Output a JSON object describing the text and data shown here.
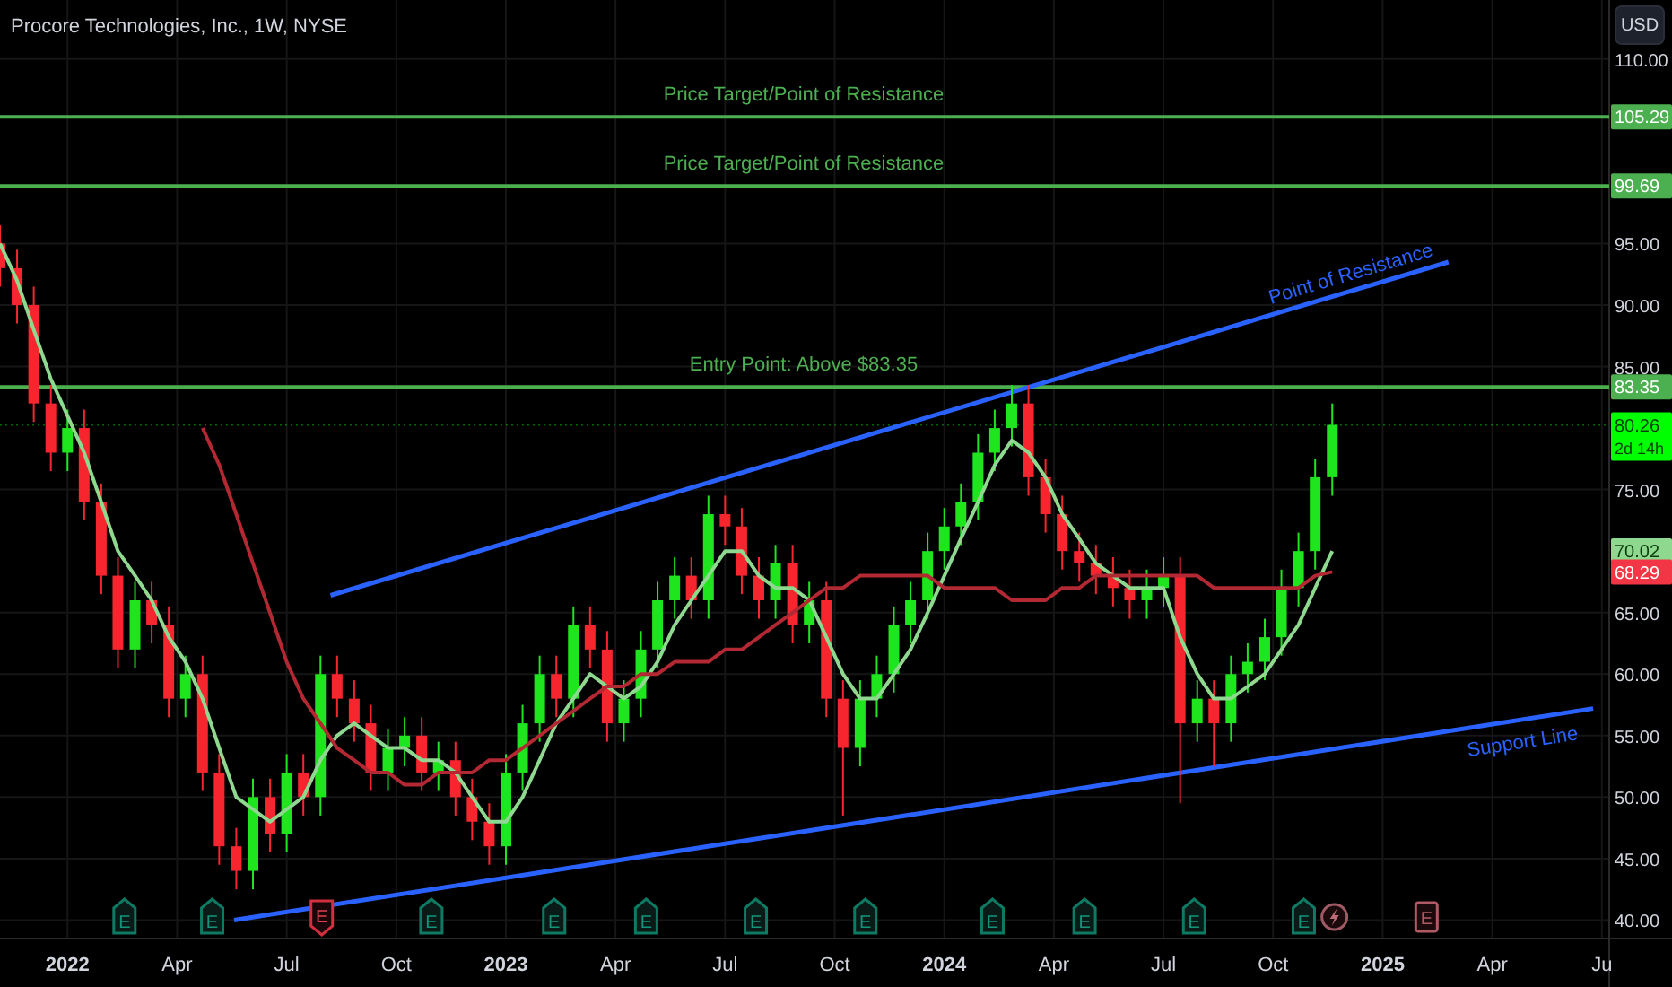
{
  "currency_button": "USD",
  "price_tags": [
    {
      "text": "105.29",
      "color": "#4caf50"
    },
    {
      "text": "99.69",
      "color": "#4caf50"
    },
    {
      "text": "83.35",
      "color": "#4caf50"
    },
    {
      "text": "80.26",
      "subtext": "2d 14h",
      "color": "#00ff00"
    },
    {
      "text": "70.02",
      "color": "#8fd88f"
    },
    {
      "text": "68.29",
      "color": "#f23645"
    }
  ],
  "trend_lines": [
    {
      "label": "Point of Resistance"
    },
    {
      "label": "Support Line"
    }
  ],
  "events": [
    {
      "kind": "earnings",
      "label": "E"
    },
    {
      "kind": "earnings",
      "label": "E"
    },
    {
      "kind": "earnings_miss",
      "label": "E"
    },
    {
      "kind": "earnings",
      "label": "E"
    },
    {
      "kind": "earnings",
      "label": "E"
    },
    {
      "kind": "earnings",
      "label": "E"
    },
    {
      "kind": "earnings",
      "label": "E"
    },
    {
      "kind": "earnings",
      "label": "E"
    },
    {
      "kind": "earnings",
      "label": "E"
    },
    {
      "kind": "earnings",
      "label": "E"
    },
    {
      "kind": "earnings",
      "label": "E"
    },
    {
      "kind": "earnings",
      "label": "E"
    },
    {
      "kind": "flash"
    },
    {
      "kind": "upcoming",
      "label": "E"
    }
  ],
  "chart_data": {
    "type": "candlestick",
    "title": "Procore Technologies, Inc., 1W, NYSE",
    "xlim": [
      2021.846,
      2025.66
    ],
    "grid": true,
    "ylim": [
      38.5,
      114.8
    ],
    "x": [
      2021.846,
      2021.885,
      2021.923,
      2021.962,
      2022.0,
      2022.038,
      2022.077,
      2022.115,
      2022.154,
      2022.192,
      2022.231,
      2022.269,
      2022.308,
      2022.346,
      2022.385,
      2022.423,
      2022.462,
      2022.5,
      2022.538,
      2022.577,
      2022.615,
      2022.654,
      2022.692,
      2022.731,
      2022.769,
      2022.808,
      2022.846,
      2022.885,
      2022.923,
      2022.962,
      2023.0,
      2023.038,
      2023.077,
      2023.115,
      2023.154,
      2023.192,
      2023.231,
      2023.269,
      2023.308,
      2023.346,
      2023.385,
      2023.423,
      2023.462,
      2023.5,
      2023.538,
      2023.577,
      2023.615,
      2023.654,
      2023.692,
      2023.731,
      2023.769,
      2023.808,
      2023.846,
      2023.885,
      2023.923,
      2023.962,
      2024.0,
      2024.038,
      2024.077,
      2024.115,
      2024.154,
      2024.192,
      2024.231,
      2024.269,
      2024.308,
      2024.346,
      2024.385,
      2024.423,
      2024.462,
      2024.5,
      2024.538,
      2024.577,
      2024.615,
      2024.654,
      2024.692,
      2024.731,
      2024.769,
      2024.808,
      2024.846,
      2024.885
    ],
    "ohlc": [
      [
        95,
        96.5,
        91.5,
        93
      ],
      [
        93,
        94.5,
        88.5,
        90
      ],
      [
        90,
        91.5,
        80.5,
        82
      ],
      [
        82,
        83.5,
        76.5,
        78
      ],
      [
        78,
        81.5,
        76.5,
        80
      ],
      [
        80,
        81.5,
        72.5,
        74
      ],
      [
        74,
        75.5,
        66.5,
        68
      ],
      [
        68,
        69.5,
        60.5,
        62
      ],
      [
        62,
        67.5,
        60.5,
        66
      ],
      [
        66,
        67.5,
        62.5,
        64
      ],
      [
        64,
        65.5,
        56.5,
        58
      ],
      [
        58,
        61.5,
        56.5,
        60
      ],
      [
        60,
        61.5,
        50.5,
        52
      ],
      [
        52,
        53.5,
        44.5,
        46
      ],
      [
        46,
        47.5,
        42.5,
        44
      ],
      [
        44,
        51.5,
        42.5,
        50
      ],
      [
        50,
        51.5,
        45.5,
        47
      ],
      [
        47,
        53.5,
        45.5,
        52
      ],
      [
        52,
        53.5,
        48.5,
        50
      ],
      [
        50,
        61.5,
        48.5,
        60
      ],
      [
        60,
        61.5,
        56.5,
        58
      ],
      [
        58,
        59.5,
        54.5,
        56
      ],
      [
        56,
        57.5,
        50.5,
        52
      ],
      [
        52,
        55.5,
        50.5,
        54
      ],
      [
        54,
        56.5,
        52.5,
        55
      ],
      [
        55,
        56.5,
        50.5,
        52
      ],
      [
        52,
        54.5,
        50.5,
        53
      ],
      [
        53,
        54.5,
        48.5,
        50
      ],
      [
        50,
        51.5,
        46.5,
        48
      ],
      [
        48,
        49.5,
        44.5,
        46
      ],
      [
        46,
        53.5,
        44.5,
        52
      ],
      [
        52,
        57.5,
        50.5,
        56
      ],
      [
        56,
        61.5,
        54.5,
        60
      ],
      [
        60,
        61.5,
        56.5,
        58
      ],
      [
        58,
        65.5,
        56.5,
        64
      ],
      [
        64,
        65.5,
        60.5,
        62
      ],
      [
        62,
        63.5,
        54.5,
        56
      ],
      [
        56,
        59.5,
        54.5,
        58
      ],
      [
        58,
        63.5,
        56.5,
        62
      ],
      [
        62,
        67.5,
        60.5,
        66
      ],
      [
        66,
        69.5,
        64.5,
        68
      ],
      [
        68,
        69.5,
        64.5,
        66
      ],
      [
        66,
        74.5,
        64.5,
        73
      ],
      [
        73,
        74.5,
        70.5,
        72
      ],
      [
        72,
        73.5,
        66.5,
        68
      ],
      [
        68,
        69.5,
        64.5,
        66
      ],
      [
        66,
        70.5,
        64.5,
        69
      ],
      [
        69,
        70.5,
        62.5,
        64
      ],
      [
        64,
        67.5,
        62.5,
        66
      ],
      [
        66,
        67.5,
        56.5,
        58
      ],
      [
        58,
        59.5,
        48.5,
        54
      ],
      [
        54,
        59.5,
        52.5,
        58
      ],
      [
        58,
        61.5,
        56.5,
        60
      ],
      [
        60,
        65.5,
        58.5,
        64
      ],
      [
        64,
        67.5,
        62.5,
        66
      ],
      [
        66,
        71.5,
        64.5,
        70
      ],
      [
        70,
        73.5,
        68.5,
        72
      ],
      [
        72,
        75.5,
        70.5,
        74
      ],
      [
        74,
        79.5,
        72.5,
        78
      ],
      [
        78,
        81.5,
        76.5,
        80
      ],
      [
        80,
        83.5,
        78.5,
        82
      ],
      [
        82,
        83.5,
        74.5,
        76
      ],
      [
        76,
        77.5,
        71.5,
        73
      ],
      [
        73,
        74.5,
        68.5,
        70
      ],
      [
        70,
        71.5,
        67.5,
        69
      ],
      [
        69,
        70.5,
        66.5,
        68
      ],
      [
        68,
        69.5,
        65.5,
        67
      ],
      [
        67,
        68.5,
        64.5,
        66
      ],
      [
        66,
        68.5,
        64.5,
        67
      ],
      [
        67,
        69.5,
        65.5,
        68
      ],
      [
        68,
        69.5,
        49.5,
        56
      ],
      [
        56,
        59.5,
        54.5,
        58
      ],
      [
        58,
        59.5,
        52.5,
        56
      ],
      [
        56,
        61.5,
        54.5,
        60
      ],
      [
        60,
        62.5,
        58.5,
        61
      ],
      [
        61,
        64.5,
        59.5,
        63
      ],
      [
        63,
        68.5,
        61.5,
        67
      ],
      [
        67,
        71.5,
        65.5,
        70
      ],
      [
        70,
        77.5,
        68.5,
        76
      ],
      [
        76,
        82,
        74.5,
        80.26
      ]
    ],
    "xticks": [
      {
        "value": 2022,
        "label": "2022"
      },
      {
        "value": 2022.25,
        "label": "Apr"
      },
      {
        "value": 2022.5,
        "label": "Jul"
      },
      {
        "value": 2022.75,
        "label": "Oct"
      },
      {
        "value": 2023,
        "label": "2023"
      },
      {
        "value": 2023.25,
        "label": "Apr"
      },
      {
        "value": 2023.5,
        "label": "Jul"
      },
      {
        "value": 2023.75,
        "label": "Oct"
      },
      {
        "value": 2024,
        "label": "2024"
      },
      {
        "value": 2024.25,
        "label": "Apr"
      },
      {
        "value": 2024.5,
        "label": "Jul"
      },
      {
        "value": 2024.75,
        "label": "Oct"
      },
      {
        "value": 2025,
        "label": "2025"
      },
      {
        "value": 2025.25,
        "label": "Apr"
      },
      {
        "value": 2025.5,
        "label": "Ju"
      }
    ],
    "yticks": [
      {
        "value": 110,
        "label": "110.00"
      },
      {
        "value": 95,
        "label": "95.00"
      },
      {
        "value": 90,
        "label": "90.00"
      },
      {
        "value": 85,
        "label": "85.00"
      },
      {
        "value": 75,
        "label": "75.00"
      },
      {
        "value": 65,
        "label": "65.00"
      },
      {
        "value": 60,
        "label": "60.00"
      },
      {
        "value": 55,
        "label": "55.00"
      },
      {
        "value": 50,
        "label": "50.00"
      },
      {
        "value": 45,
        "label": "45.00"
      },
      {
        "value": 40,
        "label": "40.00"
      }
    ],
    "series": [
      {
        "type": "line",
        "color": "#8fd88f",
        "values": [
          95,
          92,
          88,
          84,
          81,
          78,
          74,
          70,
          68,
          66,
          63,
          61,
          58,
          54,
          50,
          49,
          48,
          49,
          50,
          53,
          55,
          56,
          55,
          54,
          54,
          53,
          53,
          52,
          50,
          48,
          48,
          50,
          53,
          56,
          58,
          60,
          59,
          58,
          59,
          61,
          64,
          66,
          68,
          70,
          70,
          68,
          67,
          67,
          66,
          63,
          60,
          58,
          58,
          60,
          62,
          65,
          68,
          71,
          74,
          77,
          79,
          78,
          76,
          73,
          71,
          69,
          68,
          67,
          67,
          67,
          63,
          60,
          58,
          58,
          59,
          60,
          62,
          64,
          67,
          70
        ]
      },
      {
        "type": "line",
        "color": "#b22833",
        "values": [
          null,
          null,
          null,
          null,
          null,
          null,
          null,
          null,
          null,
          null,
          null,
          null,
          80,
          77,
          73,
          69,
          65,
          61,
          58,
          56,
          54,
          53,
          52,
          52,
          51,
          51,
          52,
          52,
          52,
          53,
          53,
          54,
          55,
          56,
          57,
          58,
          59,
          59,
          60,
          60,
          61,
          61,
          61,
          62,
          62,
          63,
          64,
          65,
          66,
          67,
          67,
          68,
          68,
          68,
          68,
          68,
          67,
          67,
          67,
          67,
          66,
          66,
          66,
          67,
          67,
          68,
          68,
          68,
          68,
          68,
          68,
          68,
          67,
          67,
          67,
          67,
          67,
          67,
          68,
          68.3
        ]
      }
    ],
    "ref_lines": [
      {
        "axis": "y",
        "value": 105.29,
        "color": "#4caf50",
        "label": "Price Target/Point of Resistance"
      },
      {
        "axis": "y",
        "value": 99.69,
        "color": "#4caf50",
        "label": "Price Target/Point of Resistance"
      },
      {
        "axis": "y",
        "value": 83.35,
        "color": "#4caf50",
        "label": "Entry Point: Above $83.35"
      },
      {
        "axis": "y",
        "value": 80.26,
        "color": "#00ff00"
      }
    ]
  }
}
